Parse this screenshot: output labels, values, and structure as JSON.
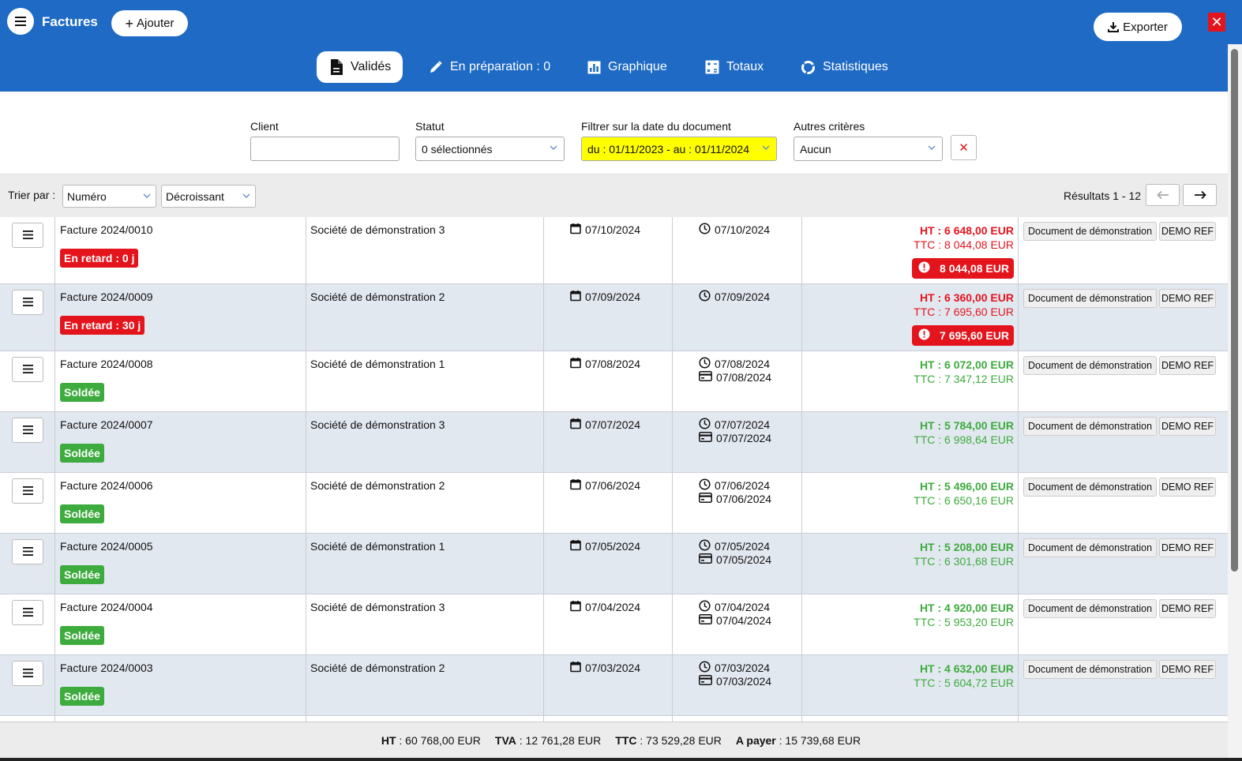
{
  "header": {
    "title": "Factures",
    "add_label": "Ajouter",
    "export_label": "Exporter",
    "close_glyph": "✕"
  },
  "tabs": [
    {
      "label": "Validés",
      "icon": "document-icon",
      "active": true
    },
    {
      "label": "En préparation : 0",
      "icon": "pencil-icon",
      "active": false
    },
    {
      "label": "Graphique",
      "icon": "chart-icon",
      "active": false
    },
    {
      "label": "Totaux",
      "icon": "calculator-icon",
      "active": false
    },
    {
      "label": "Statistiques",
      "icon": "donut-icon",
      "active": false
    }
  ],
  "filters": {
    "client_label": "Client",
    "client_value": "",
    "status_label": "Statut",
    "status_value": "0 sélectionnés",
    "date_label": "Filtrer sur la date du document",
    "date_value": "du : 01/11/2023 - au : 01/11/2024",
    "other_label": "Autres critères",
    "other_value": "Aucun",
    "clear_glyph": "✕"
  },
  "sort": {
    "label": "Trier par :",
    "field": "Numéro",
    "order": "Décroissant",
    "results": "Résultats 1 - 12"
  },
  "invoices": [
    {
      "number": "Facture 2024/0010",
      "status": "En retard : 0 j",
      "status_color": "#e4141c",
      "client": "Société de démonstration 3",
      "doc_date": "07/10/2024",
      "due_date": "07/10/2024",
      "pay_date": "",
      "ht": "HT : 6 648,00 EUR",
      "ttc": "TTC : 8 044,08 EUR",
      "due_amount": "8 044,08 EUR",
      "amount_color": "#e4141c",
      "doc_label": "Document de démonstration",
      "ref_label": "DEMO REF"
    },
    {
      "number": "Facture 2024/0009",
      "status": "En retard : 30 j",
      "status_color": "#e4141c",
      "client": "Société de démonstration 2",
      "doc_date": "07/09/2024",
      "due_date": "07/09/2024",
      "pay_date": "",
      "ht": "HT : 6 360,00 EUR",
      "ttc": "TTC : 7 695,60 EUR",
      "due_amount": "7 695,60 EUR",
      "amount_color": "#e4141c",
      "doc_label": "Document de démonstration",
      "ref_label": "DEMO REF"
    },
    {
      "number": "Facture 2024/0008",
      "status": "Soldée",
      "status_color": "#3dab3d",
      "client": "Société de démonstration 1",
      "doc_date": "07/08/2024",
      "due_date": "07/08/2024",
      "pay_date": "07/08/2024",
      "ht": "HT : 6 072,00 EUR",
      "ttc": "TTC : 7 347,12 EUR",
      "due_amount": "",
      "amount_color": "#3dab3d",
      "doc_label": "Document de démonstration",
      "ref_label": "DEMO REF"
    },
    {
      "number": "Facture 2024/0007",
      "status": "Soldée",
      "status_color": "#3dab3d",
      "client": "Société de démonstration 3",
      "doc_date": "07/07/2024",
      "due_date": "07/07/2024",
      "pay_date": "07/07/2024",
      "ht": "HT : 5 784,00 EUR",
      "ttc": "TTC : 6 998,64 EUR",
      "due_amount": "",
      "amount_color": "#3dab3d",
      "doc_label": "Document de démonstration",
      "ref_label": "DEMO REF"
    },
    {
      "number": "Facture 2024/0006",
      "status": "Soldée",
      "status_color": "#3dab3d",
      "client": "Société de démonstration 2",
      "doc_date": "07/06/2024",
      "due_date": "07/06/2024",
      "pay_date": "07/06/2024",
      "ht": "HT : 5 496,00 EUR",
      "ttc": "TTC : 6 650,16 EUR",
      "due_amount": "",
      "amount_color": "#3dab3d",
      "doc_label": "Document de démonstration",
      "ref_label": "DEMO REF"
    },
    {
      "number": "Facture 2024/0005",
      "status": "Soldée",
      "status_color": "#3dab3d",
      "client": "Société de démonstration 1",
      "doc_date": "07/05/2024",
      "due_date": "07/05/2024",
      "pay_date": "07/05/2024",
      "ht": "HT : 5 208,00 EUR",
      "ttc": "TTC : 6 301,68 EUR",
      "due_amount": "",
      "amount_color": "#3dab3d",
      "doc_label": "Document de démonstration",
      "ref_label": "DEMO REF"
    },
    {
      "number": "Facture 2024/0004",
      "status": "Soldée",
      "status_color": "#3dab3d",
      "client": "Société de démonstration 3",
      "doc_date": "07/04/2024",
      "due_date": "07/04/2024",
      "pay_date": "07/04/2024",
      "ht": "HT : 4 920,00 EUR",
      "ttc": "TTC : 5 953,20 EUR",
      "due_amount": "",
      "amount_color": "#3dab3d",
      "doc_label": "Document de démonstration",
      "ref_label": "DEMO REF"
    },
    {
      "number": "Facture 2024/0003",
      "status": "Soldée",
      "status_color": "#3dab3d",
      "client": "Société de démonstration 2",
      "doc_date": "07/03/2024",
      "due_date": "07/03/2024",
      "pay_date": "07/03/2024",
      "ht": "HT : 4 632,00 EUR",
      "ttc": "TTC : 5 604,72 EUR",
      "due_amount": "",
      "amount_color": "#3dab3d",
      "doc_label": "Document de démonstration",
      "ref_label": "DEMO REF"
    }
  ],
  "totals": {
    "ht_label": "HT",
    "ht_value": ": 60 768,00 EUR",
    "tva_label": "TVA",
    "tva_value": ": 12 761,28 EUR",
    "ttc_label": "TTC",
    "ttc_value": ": 73 529,28 EUR",
    "pay_label": "A payer",
    "pay_value": ": 15 739,68 EUR"
  }
}
